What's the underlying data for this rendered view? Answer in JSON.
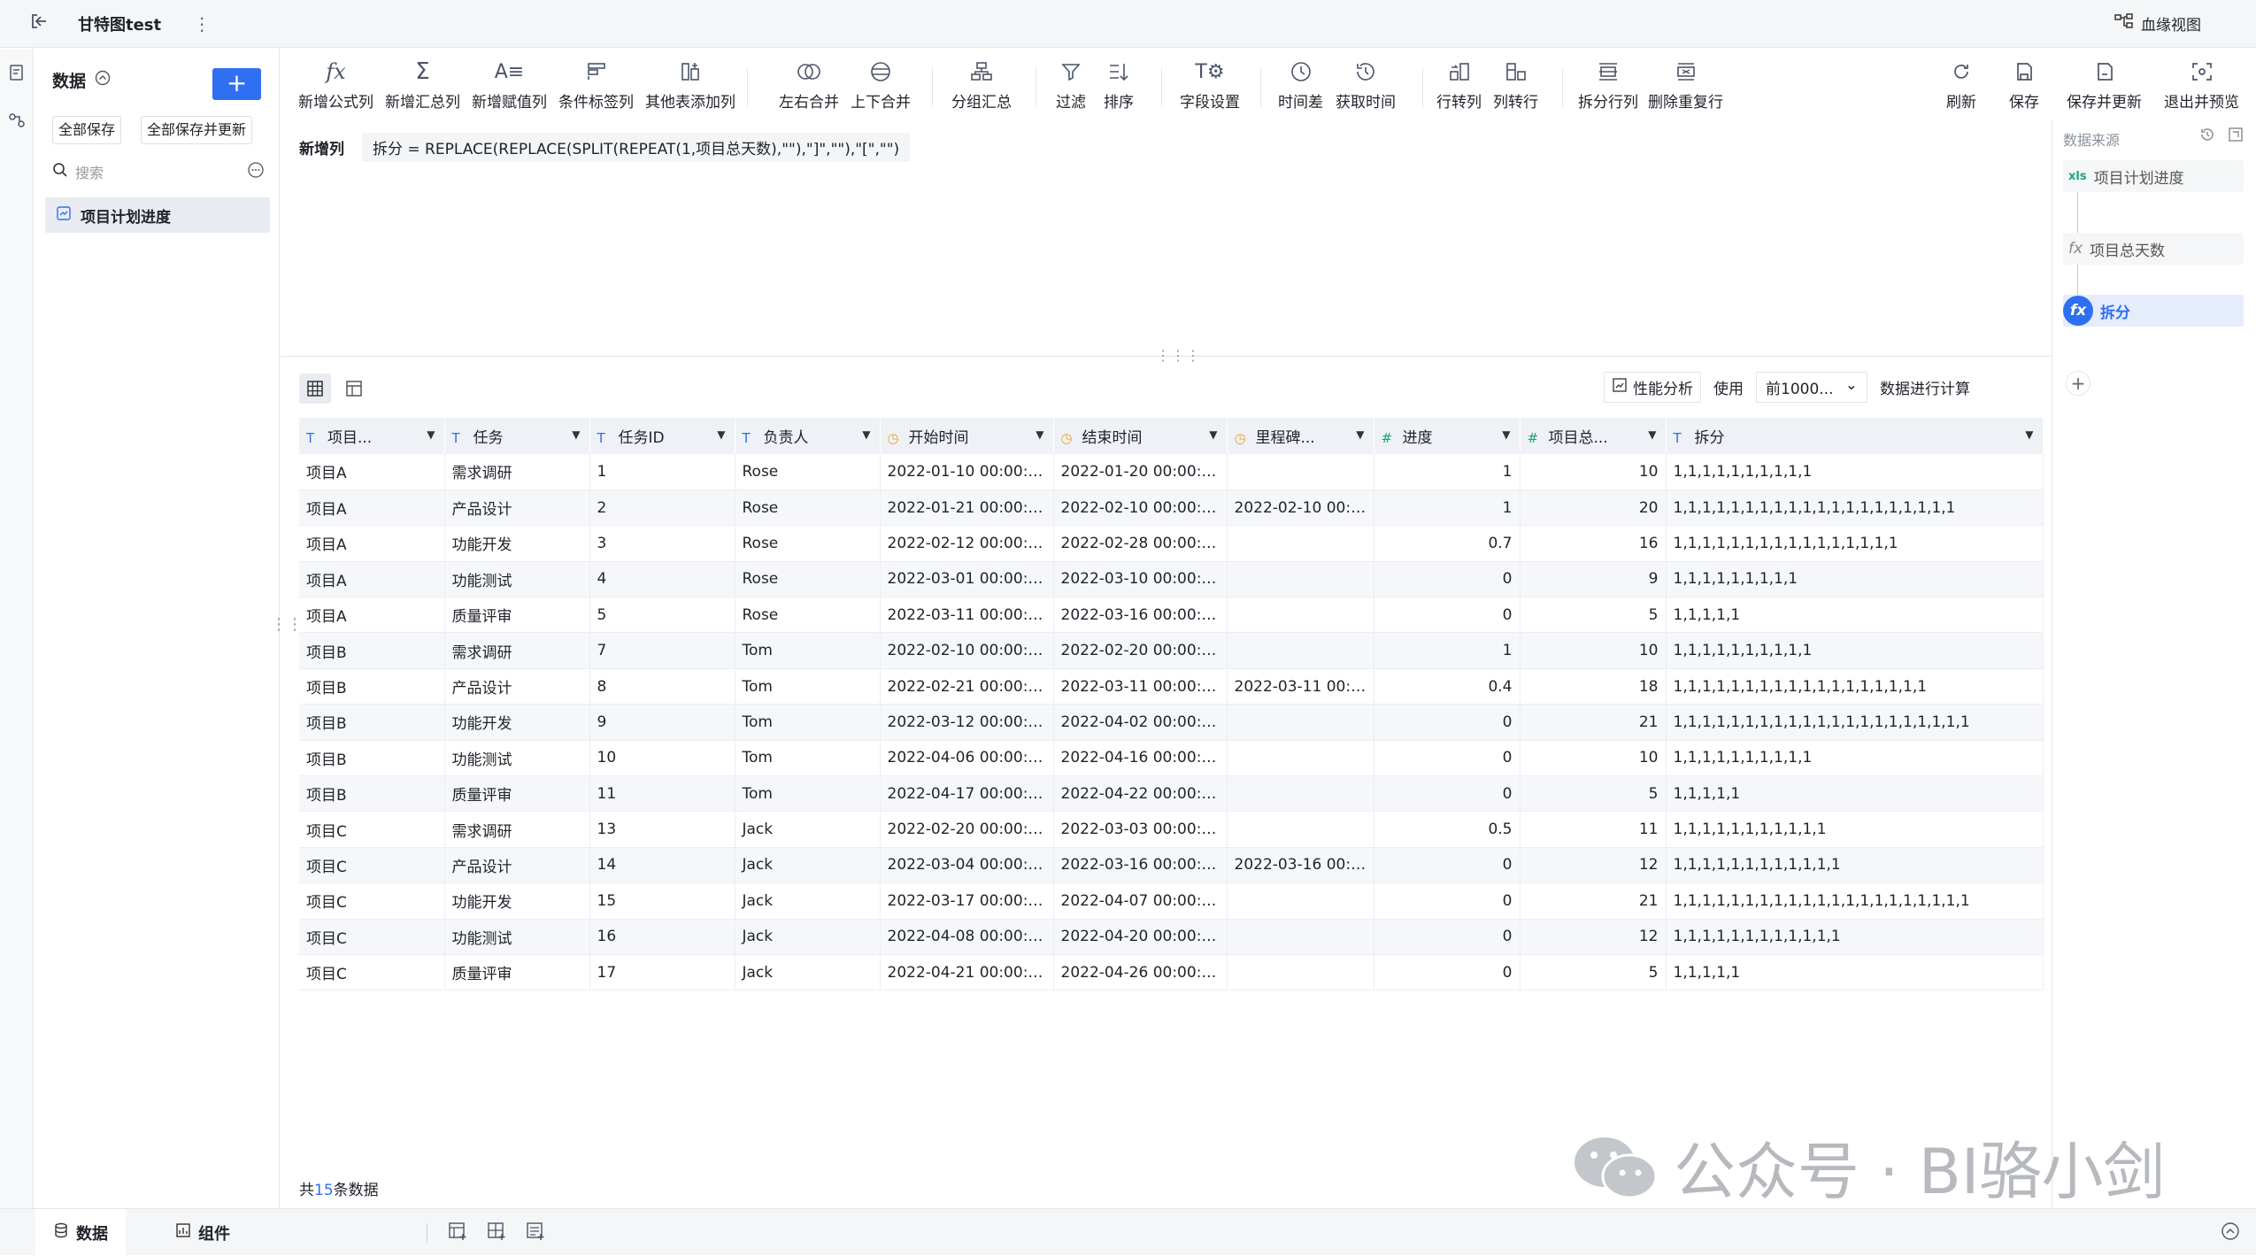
{
  "header": {
    "back_icon": "exit-icon",
    "title": "甘特图test",
    "more": "⋮",
    "lineage_label": "血缘视图"
  },
  "sidebar": {
    "title": "数据",
    "add": "+",
    "save_all": "全部保存",
    "save_all_update": "全部保存并更新",
    "search_placeholder": "搜索",
    "dataset": "项目计划进度"
  },
  "toolbar": {
    "add_formula_col": "新增公式列",
    "add_summary_col": "新增汇总列",
    "add_assign_col": "新增赋值列",
    "cond_tag_col": "条件标签列",
    "other_table_col": "其他表添加列",
    "left_right_merge": "左右合并",
    "up_down_merge": "上下合并",
    "group_summary": "分组汇总",
    "filter": "过滤",
    "sort": "排序",
    "field_settings": "字段设置",
    "time_diff": "时间差",
    "get_time": "获取时间",
    "row_to_col": "行转列",
    "col_to_row": "列转行",
    "split_rows": "拆分行列",
    "remove_dup": "删除重复行",
    "refresh": "刷新",
    "save": "保存",
    "save_update": "保存并更新",
    "exit_preview": "退出并预览"
  },
  "formula": {
    "label": "新增列",
    "expr": "拆分 = REPLACE(REPLACE(SPLIT(REPEAT(1,项目总天数),\"\"),\"]\",\"\"),\"[\",\"\")"
  },
  "perf": {
    "button": "性能分析",
    "use": "使用",
    "select": "前1000...",
    "suffix": "数据进行计算"
  },
  "table": {
    "columns": [
      {
        "label": "项目...",
        "type": "T"
      },
      {
        "label": "任务",
        "type": "T"
      },
      {
        "label": "任务ID",
        "type": "T"
      },
      {
        "label": "负责人",
        "type": "T"
      },
      {
        "label": "开始时间",
        "type": "clock"
      },
      {
        "label": "结束时间",
        "type": "clock"
      },
      {
        "label": "里程碑...",
        "type": "clock"
      },
      {
        "label": "进度",
        "type": "#"
      },
      {
        "label": "项目总...",
        "type": "#"
      },
      {
        "label": "拆分",
        "type": "T"
      }
    ],
    "rows": [
      [
        "项目A",
        "需求调研",
        "1",
        "Rose",
        "2022-01-10 00:00:00",
        "2022-01-20 00:00:00",
        "",
        "1",
        "10",
        "1,1,1,1,1,1,1,1,1,1"
      ],
      [
        "项目A",
        "产品设计",
        "2",
        "Rose",
        "2022-01-21 00:00:00",
        "2022-02-10 00:00:00",
        "2022-02-10 00:0...",
        "1",
        "20",
        "1,1,1,1,1,1,1,1,1,1,1,1,1,1,1,1,1,1,1,1"
      ],
      [
        "项目A",
        "功能开发",
        "3",
        "Rose",
        "2022-02-12 00:00:00",
        "2022-02-28 00:00:00",
        "",
        "0.7",
        "16",
        "1,1,1,1,1,1,1,1,1,1,1,1,1,1,1,1"
      ],
      [
        "项目A",
        "功能测试",
        "4",
        "Rose",
        "2022-03-01 00:00:00",
        "2022-03-10 00:00:00",
        "",
        "0",
        "9",
        "1,1,1,1,1,1,1,1,1"
      ],
      [
        "项目A",
        "质量评审",
        "5",
        "Rose",
        "2022-03-11 00:00:00",
        "2022-03-16 00:00:00",
        "",
        "0",
        "5",
        "1,1,1,1,1"
      ],
      [
        "项目B",
        "需求调研",
        "7",
        "Tom",
        "2022-02-10 00:00:00",
        "2022-02-20 00:00:00",
        "",
        "1",
        "10",
        "1,1,1,1,1,1,1,1,1,1"
      ],
      [
        "项目B",
        "产品设计",
        "8",
        "Tom",
        "2022-02-21 00:00:00",
        "2022-03-11 00:00:00",
        "2022-03-11 00:0...",
        "0.4",
        "18",
        "1,1,1,1,1,1,1,1,1,1,1,1,1,1,1,1,1,1"
      ],
      [
        "项目B",
        "功能开发",
        "9",
        "Tom",
        "2022-03-12 00:00:00",
        "2022-04-02 00:00:00",
        "",
        "0",
        "21",
        "1,1,1,1,1,1,1,1,1,1,1,1,1,1,1,1,1,1,1,1,1"
      ],
      [
        "项目B",
        "功能测试",
        "10",
        "Tom",
        "2022-04-06 00:00:00",
        "2022-04-16 00:00:00",
        "",
        "0",
        "10",
        "1,1,1,1,1,1,1,1,1,1"
      ],
      [
        "项目B",
        "质量评审",
        "11",
        "Tom",
        "2022-04-17 00:00:00",
        "2022-04-22 00:00:00",
        "",
        "0",
        "5",
        "1,1,1,1,1"
      ],
      [
        "项目C",
        "需求调研",
        "13",
        "Jack",
        "2022-02-20 00:00:00",
        "2022-03-03 00:00:00",
        "",
        "0.5",
        "11",
        "1,1,1,1,1,1,1,1,1,1,1"
      ],
      [
        "项目C",
        "产品设计",
        "14",
        "Jack",
        "2022-03-04 00:00:00",
        "2022-03-16 00:00:00",
        "2022-03-16 00:0...",
        "0",
        "12",
        "1,1,1,1,1,1,1,1,1,1,1,1"
      ],
      [
        "项目C",
        "功能开发",
        "15",
        "Jack",
        "2022-03-17 00:00:00",
        "2022-04-07 00:00:00",
        "",
        "0",
        "21",
        "1,1,1,1,1,1,1,1,1,1,1,1,1,1,1,1,1,1,1,1,1"
      ],
      [
        "项目C",
        "功能测试",
        "16",
        "Jack",
        "2022-04-08 00:00:00",
        "2022-04-20 00:00:00",
        "",
        "0",
        "12",
        "1,1,1,1,1,1,1,1,1,1,1,1"
      ],
      [
        "项目C",
        "质量评审",
        "17",
        "Jack",
        "2022-04-21 00:00:00",
        "2022-04-26 00:00:00",
        "",
        "0",
        "5",
        "1,1,1,1,1"
      ]
    ]
  },
  "footer_count": {
    "prefix": "共",
    "n": "15",
    "suffix": "条数据"
  },
  "right_panel": {
    "title": "数据来源",
    "node1": "项目计划进度",
    "node1_badge": "xls",
    "node2": "项目总天数",
    "node3": "拆分",
    "fx": "fx",
    "add": "+"
  },
  "bottom": {
    "tab_data": "数据",
    "tab_component": "组件"
  },
  "watermark": {
    "text": "公众号 · BI骆小剑"
  }
}
